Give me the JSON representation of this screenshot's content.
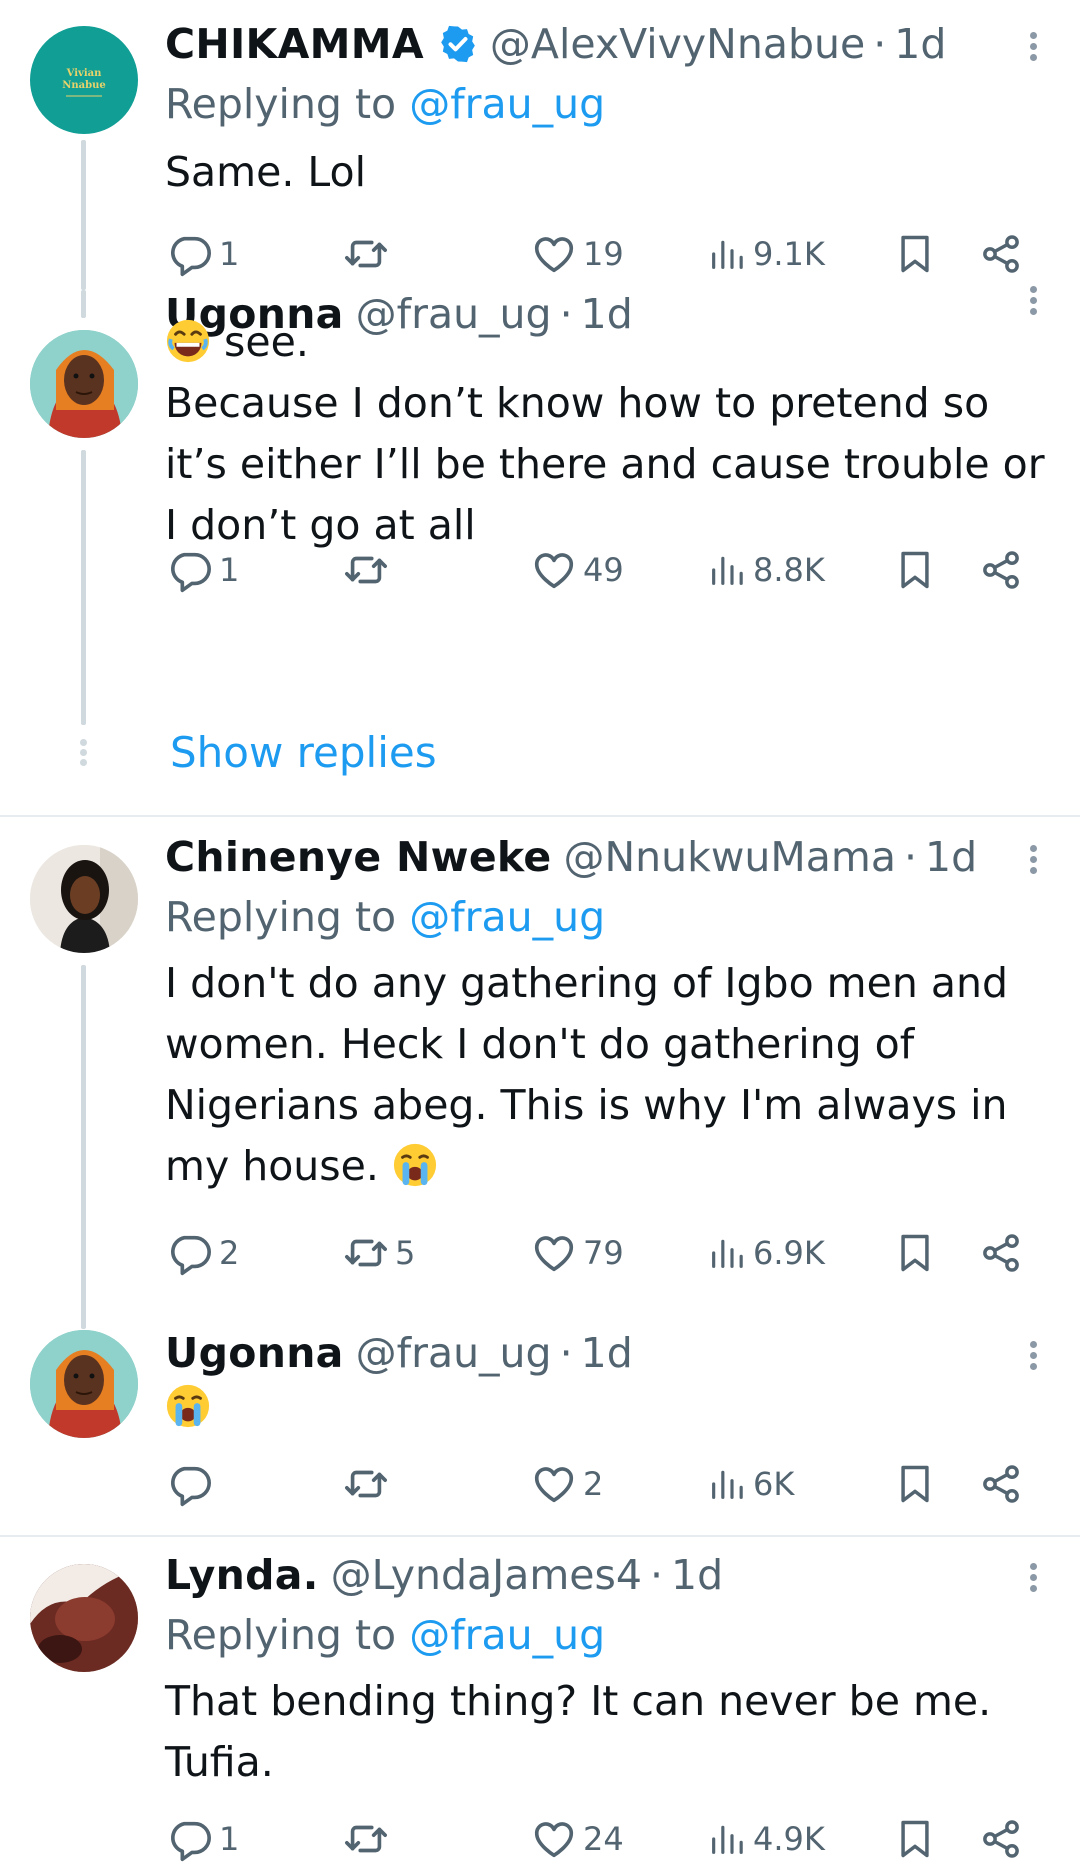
{
  "tweets": [
    {
      "name": "CHIKAMMA",
      "verified": true,
      "handle": "@AlexVivyNnabue",
      "time": "1d",
      "replying_prefix": "Replying to",
      "replying_to": "@frau_ug",
      "text_lines": [
        "Same. Lol"
      ],
      "avatar_text": [
        "Vivian",
        "Nnabue"
      ],
      "stats": {
        "replies": "1",
        "retweets": "",
        "likes": "19",
        "views": "9.1K"
      }
    },
    {
      "name": "Ugonna",
      "handle": "@frau_ug",
      "time": "1d",
      "text_lines": [
        "see.",
        "Because I don’t know how to pretend so",
        "it’s either I’ll be there and cause trouble or",
        "I don’t go at all"
      ],
      "stats": {
        "replies": "1",
        "retweets": "",
        "likes": "49",
        "views": "8.8K"
      }
    },
    {
      "name": "Chinenye Nweke",
      "handle": "@NnukwuMama",
      "time": "1d",
      "replying_prefix": "Replying to",
      "replying_to": "@frau_ug",
      "text_lines": [
        "I don't do any gathering of Igbo men and",
        "women. Heck I don't do gathering of",
        "Nigerians abeg. This is why I'm always in",
        "my house."
      ],
      "stats": {
        "replies": "2",
        "retweets": "5",
        "likes": "79",
        "views": "6.9K"
      }
    },
    {
      "name": "Ugonna",
      "handle": "@frau_ug",
      "time": "1d",
      "text_lines": [],
      "stats": {
        "replies": "",
        "retweets": "",
        "likes": "2",
        "views": "6K"
      }
    },
    {
      "name": "Lynda.",
      "handle": "@LyndaJames4",
      "time": "1d",
      "replying_prefix": "Replying to",
      "replying_to": "@frau_ug",
      "text_lines": [
        "That bending thing? It can never be me.",
        "Tufia."
      ],
      "stats": {
        "replies": "1",
        "retweets": "",
        "likes": "24",
        "views": "4.9K"
      }
    }
  ],
  "show_replies_label": "Show replies",
  "separator": "·",
  "colors": {
    "accent": "#1d9bf0",
    "muted": "#536471",
    "text": "#0f1419",
    "line": "#cfd9de"
  }
}
